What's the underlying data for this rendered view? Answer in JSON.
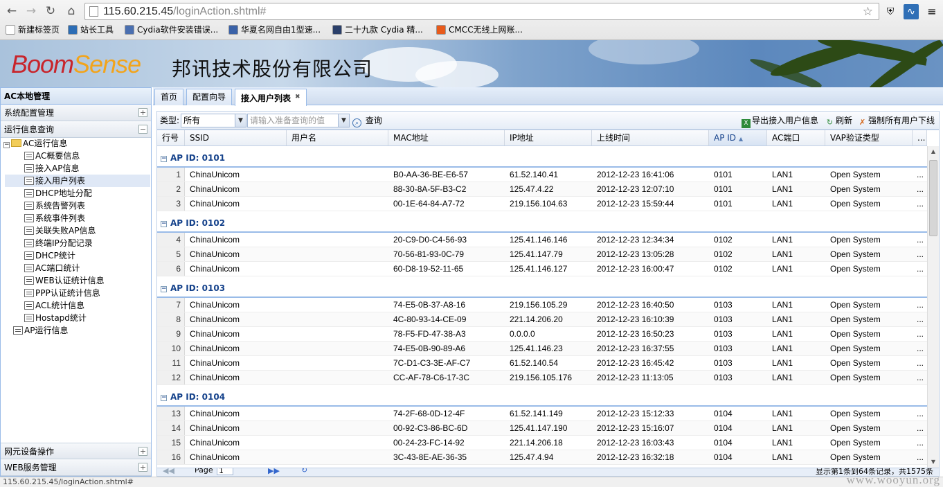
{
  "browser": {
    "url_host": "115.60.215.45",
    "url_path": "/loginAction.shtml#",
    "bookmarks": [
      {
        "label": "新建标签页",
        "icon": "page-icon",
        "color": "#ffffff"
      },
      {
        "label": "站长工具",
        "icon": "tool-icon",
        "color": "#2c6db5"
      },
      {
        "label": "Cydia软件安装错误...",
        "icon": "globe-icon",
        "color": "#4a6fb0"
      },
      {
        "label": "华夏名网自由1型速...",
        "icon": "globe-icon",
        "color": "#3a62a8"
      },
      {
        "label": "二十九款 Cydia 精...",
        "icon": "app-icon",
        "color": "#2a3f6a"
      },
      {
        "label": "CMCC无线上网账...",
        "icon": "taobao-icon",
        "color": "#e85a1a"
      }
    ]
  },
  "header": {
    "logo_left": "Boom",
    "logo_right": "Sense",
    "company": "邦讯技术股份有限公司"
  },
  "sidebar": {
    "title": "AC本地管理",
    "top_sections": [
      "系统配置管理",
      "运行信息查询"
    ],
    "tree_root": "AC运行信息",
    "tree_items": [
      "AC概要信息",
      "接入AP信息",
      "接入用户列表",
      "DHCP地址分配",
      "系统告警列表",
      "系统事件列表",
      "关联失败AP信息",
      "终端IP分配记录",
      "DHCP统计",
      "AC端口统计",
      "WEB认证统计信息",
      "PPP认证统计信息",
      "ACL统计信息",
      "Hostapd统计"
    ],
    "tree_root2": "AP运行信息",
    "bottom_sections": [
      "网元设备操作",
      "WEB服务管理"
    ],
    "toggle_plus": "+",
    "toggle_minus": "−"
  },
  "tabs": [
    {
      "label": "首页"
    },
    {
      "label": "配置向导"
    },
    {
      "label": "接入用户列表",
      "active": true
    }
  ],
  "toolbar": {
    "type_label": "类型:",
    "type_value": "所有",
    "search_placeholder": "请输入准备查询的值",
    "query_label": "查询",
    "export_label": "导出接入用户信息",
    "refresh_label": "刷新",
    "force_offline_label": "强制所有用户下线"
  },
  "grid": {
    "columns": [
      "行号",
      "SSID",
      "用户名",
      "MAC地址",
      "IP地址",
      "上线时间",
      "AP ID",
      "AC端口",
      "VAP验证类型",
      "..."
    ],
    "sort_indicator": "▲",
    "group_prefix": "AP ID: ",
    "groups": [
      {
        "ap_id": "0101",
        "rows": [
          {
            "n": "1",
            "ssid": "ChinaUnicom",
            "user": "",
            "mac": "B0-AA-36-BE-E6-57",
            "ip": "61.52.140.41",
            "time": "2012-12-23 16:41:06",
            "ap": "0101",
            "port": "LAN1",
            "vap": "Open System",
            "more": "..."
          },
          {
            "n": "2",
            "ssid": "ChinaUnicom",
            "user": "",
            "mac": "88-30-8A-5F-B3-C2",
            "ip": "125.47.4.22",
            "time": "2012-12-23 12:07:10",
            "ap": "0101",
            "port": "LAN1",
            "vap": "Open System",
            "more": "..."
          },
          {
            "n": "3",
            "ssid": "ChinaUnicom",
            "user": "",
            "mac": "00-1E-64-84-A7-72",
            "ip": "219.156.104.63",
            "time": "2012-12-23 15:59:44",
            "ap": "0101",
            "port": "LAN1",
            "vap": "Open System",
            "more": "..."
          }
        ]
      },
      {
        "ap_id": "0102",
        "rows": [
          {
            "n": "4",
            "ssid": "ChinaUnicom",
            "user": "",
            "mac": "20-C9-D0-C4-56-93",
            "ip": "125.41.146.146",
            "time": "2012-12-23 12:34:34",
            "ap": "0102",
            "port": "LAN1",
            "vap": "Open System",
            "more": "..."
          },
          {
            "n": "5",
            "ssid": "ChinaUnicom",
            "user": "",
            "mac": "70-56-81-93-0C-79",
            "ip": "125.41.147.79",
            "time": "2012-12-23 13:05:28",
            "ap": "0102",
            "port": "LAN1",
            "vap": "Open System",
            "more": "..."
          },
          {
            "n": "6",
            "ssid": "ChinaUnicom",
            "user": "",
            "mac": "60-D8-19-52-11-65",
            "ip": "125.41.146.127",
            "time": "2012-12-23 16:00:47",
            "ap": "0102",
            "port": "LAN1",
            "vap": "Open System",
            "more": "..."
          }
        ]
      },
      {
        "ap_id": "0103",
        "rows": [
          {
            "n": "7",
            "ssid": "ChinaUnicom",
            "user": "",
            "mac": "74-E5-0B-37-A8-16",
            "ip": "219.156.105.29",
            "time": "2012-12-23 16:40:50",
            "ap": "0103",
            "port": "LAN1",
            "vap": "Open System",
            "more": "..."
          },
          {
            "n": "8",
            "ssid": "ChinaUnicom",
            "user": "",
            "mac": "4C-80-93-14-CE-09",
            "ip": "221.14.206.20",
            "time": "2012-12-23 16:10:39",
            "ap": "0103",
            "port": "LAN1",
            "vap": "Open System",
            "more": "..."
          },
          {
            "n": "9",
            "ssid": "ChinaUnicom",
            "user": "",
            "mac": "78-F5-FD-47-38-A3",
            "ip": "0.0.0.0",
            "time": "2012-12-23 16:50:23",
            "ap": "0103",
            "port": "LAN1",
            "vap": "Open System",
            "more": "..."
          },
          {
            "n": "10",
            "ssid": "ChinaUnicom",
            "user": "",
            "mac": "74-E5-0B-90-89-A6",
            "ip": "125.41.146.23",
            "time": "2012-12-23 16:37:55",
            "ap": "0103",
            "port": "LAN1",
            "vap": "Open System",
            "more": "..."
          },
          {
            "n": "11",
            "ssid": "ChinaUnicom",
            "user": "",
            "mac": "7C-D1-C3-3E-AF-C7",
            "ip": "61.52.140.54",
            "time": "2012-12-23 16:45:42",
            "ap": "0103",
            "port": "LAN1",
            "vap": "Open System",
            "more": "..."
          },
          {
            "n": "12",
            "ssid": "ChinaUnicom",
            "user": "",
            "mac": "CC-AF-78-C6-17-3C",
            "ip": "219.156.105.176",
            "time": "2012-12-23 11:13:05",
            "ap": "0103",
            "port": "LAN1",
            "vap": "Open System",
            "more": "..."
          }
        ]
      },
      {
        "ap_id": "0104",
        "rows": [
          {
            "n": "13",
            "ssid": "ChinaUnicom",
            "user": "",
            "mac": "74-2F-68-0D-12-4F",
            "ip": "61.52.141.149",
            "time": "2012-12-23 15:12:33",
            "ap": "0104",
            "port": "LAN1",
            "vap": "Open System",
            "more": "..."
          },
          {
            "n": "14",
            "ssid": "ChinaUnicom",
            "user": "",
            "mac": "00-92-C3-86-BC-6D",
            "ip": "125.41.147.190",
            "time": "2012-12-23 15:16:07",
            "ap": "0104",
            "port": "LAN1",
            "vap": "Open System",
            "more": "..."
          },
          {
            "n": "15",
            "ssid": "ChinaUnicom",
            "user": "",
            "mac": "00-24-23-FC-14-92",
            "ip": "221.14.206.18",
            "time": "2012-12-23 16:03:43",
            "ap": "0104",
            "port": "LAN1",
            "vap": "Open System",
            "more": "..."
          },
          {
            "n": "16",
            "ssid": "ChinaUnicom",
            "user": "",
            "mac": "3C-43-8E-AE-36-35",
            "ip": "125.47.4.94",
            "time": "2012-12-23 16:32:18",
            "ap": "0104",
            "port": "LAN1",
            "vap": "Open System",
            "more": "..."
          }
        ]
      }
    ]
  },
  "pager": {
    "page_label": "Page",
    "page_value": "1",
    "summary": "显示第1条到64条记录，共1575条"
  },
  "status_url": "115.60.215.45/loginAction.shtml#",
  "watermark": "www.wooyun.org"
}
